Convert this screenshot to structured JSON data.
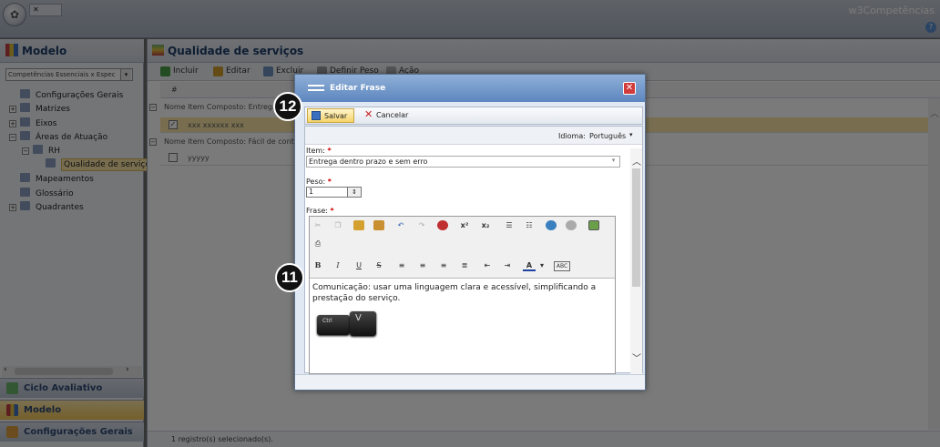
{
  "topbar": {
    "tab_label": "",
    "brand": "w3Competências",
    "help": "?"
  },
  "left": {
    "title": "Modelo",
    "select_value": "Competências Essenciais x Espec",
    "tree": [
      {
        "label": "Configurações Gerais",
        "indent": 0,
        "expander": ""
      },
      {
        "label": "Matrizes",
        "indent": 0,
        "expander": "+"
      },
      {
        "label": "Eixos",
        "indent": 0,
        "expander": "+"
      },
      {
        "label": "Áreas de Atuação",
        "indent": 0,
        "expander": "−"
      },
      {
        "label": "RH",
        "indent": 1,
        "expander": "−"
      },
      {
        "label": "Qualidade de serviços",
        "indent": 2,
        "expander": "",
        "selected": true
      },
      {
        "label": "Mapeamentos",
        "indent": 0,
        "expander": ""
      },
      {
        "label": "Glossário",
        "indent": 0,
        "expander": ""
      },
      {
        "label": "Quadrantes",
        "indent": 0,
        "expander": "+"
      }
    ],
    "nav": [
      "Ciclo Avaliativo",
      "Modelo",
      "Configurações Gerais"
    ]
  },
  "main": {
    "title": "Qualidade de serviços",
    "toolbar": [
      "Incluir",
      "Editar",
      "Excluir",
      "Definir Peso",
      "Ação"
    ],
    "grid_header": "#",
    "groups": [
      {
        "label": "Nome Item Composto: Entregar",
        "row": "xxx xxxxxx xxx",
        "checked": true
      },
      {
        "label": "Nome Item Composto: Fácil de contato",
        "row": "yyyyy",
        "checked": false
      }
    ],
    "status": "1 registro(s) selecionado(s)."
  },
  "modal": {
    "title": "Editar Frase",
    "save": "Salvar",
    "cancel": "Cancelar",
    "idioma_label": "Idioma:",
    "idioma_value": "Português",
    "item_label": "Item:",
    "item_value": "Entrega dentro prazo e sem erro",
    "peso_label": "Peso:",
    "peso_value": "1",
    "frase_label": "Frase:",
    "required": "*",
    "frase_text": "Comunicação: usar uma linguagem clara e acessível, simplificando a prestação do serviço.",
    "key_ctrl": "Ctrl",
    "key_v": "V"
  },
  "badges": {
    "b12": "12",
    "b11": "11"
  },
  "colors": {
    "accent": "#5d86bf",
    "selected": "#fbe6a6",
    "close": "#d23b3b"
  }
}
